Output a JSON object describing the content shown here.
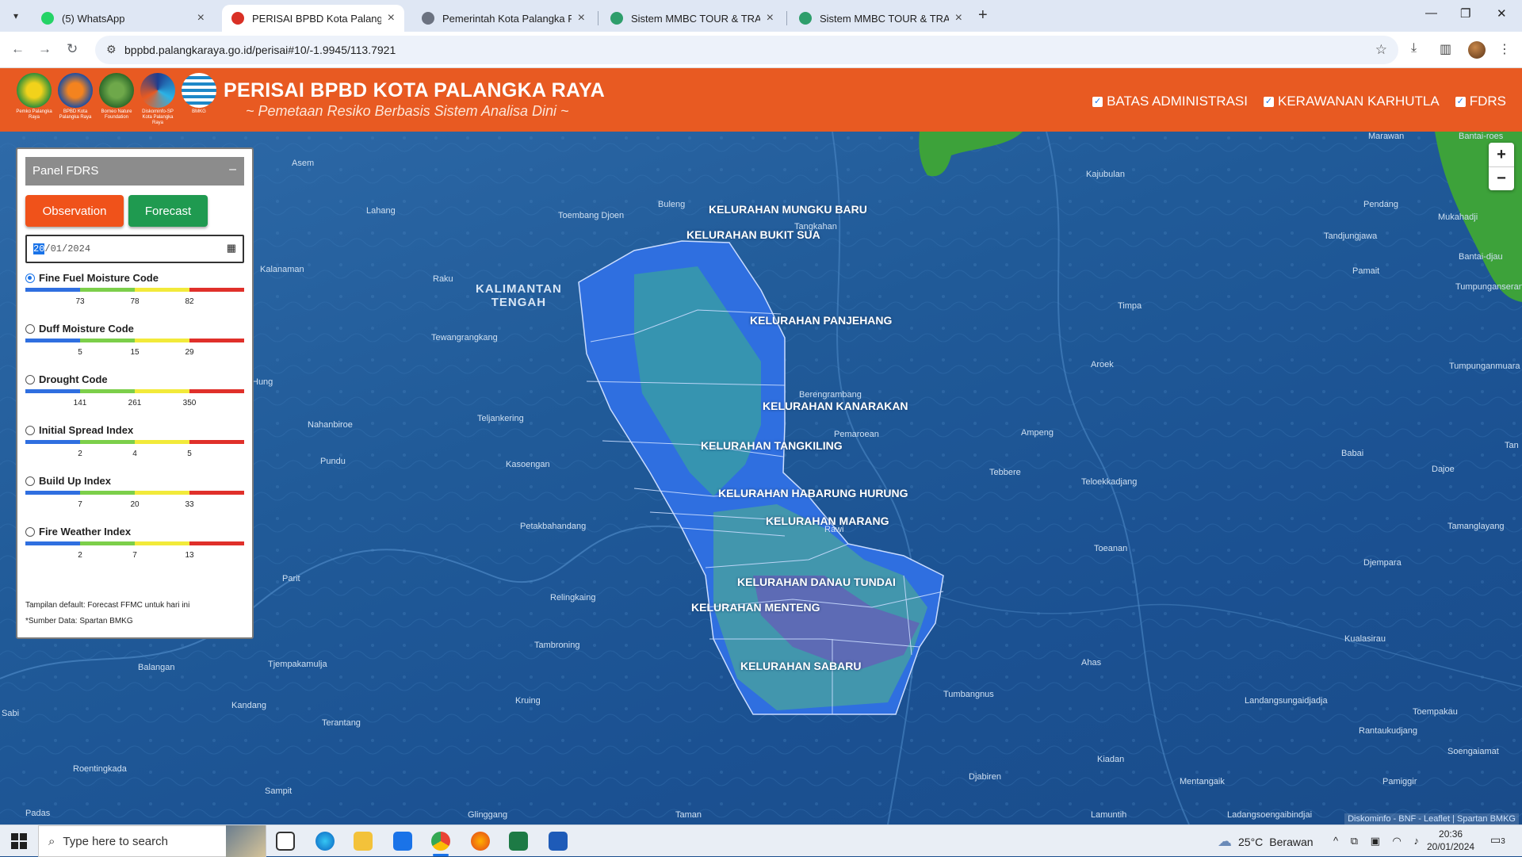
{
  "browser": {
    "tabs": [
      {
        "label": "(5) WhatsApp",
        "active": false,
        "color": "#25d366"
      },
      {
        "label": "PERISAI BPBD Kota Palangka Ra",
        "active": true,
        "color": "#d93025"
      },
      {
        "label": "Pemerintah Kota Palangka Raya",
        "active": false,
        "color": "#5f6368"
      },
      {
        "label": "Sistem MMBC TOUR & TRAVEL",
        "active": false,
        "color": "#2e9e6b"
      },
      {
        "label": "Sistem MMBC TOUR & TRAVEL",
        "active": false,
        "color": "#2e9e6b"
      }
    ],
    "url": "bppbd.palangkaraya.go.id/perisai#10/-1.9945/113.7921"
  },
  "header": {
    "title": "PERISAI BPBD KOTA PALANGKA RAYA",
    "subtitle": "~ Pemetaan Resiko Berbasis Sistem Analisa Dini ~",
    "logos": [
      {
        "caption": "Pemko Palangka Raya",
        "color": "#2f8f3a"
      },
      {
        "caption": "BPBD Kota Palangka Raya",
        "color": "#1f4fa0"
      },
      {
        "caption": "Borneo Nature Foundation",
        "color": "#2e6b2a"
      },
      {
        "caption": "Diskominfo-SP Kota Palangka Raya",
        "color": "#1d3d8f"
      },
      {
        "caption": "BMKG",
        "color": "#1e88c8"
      }
    ],
    "layers": [
      {
        "label": "BATAS ADMINISTRASI",
        "checked": true
      },
      {
        "label": "KERAWANAN KARHUTLA",
        "checked": true
      },
      {
        "label": "FDRS",
        "checked": true
      }
    ]
  },
  "panel": {
    "title": "Panel FDRS",
    "minimize": "–",
    "observation_label": "Observation",
    "forecast_label": "Forecast",
    "date_day": "20",
    "date_rest": "/01/2024",
    "scale_colors": [
      "#2f6fe0",
      "#7ccf4a",
      "#f2ea3a",
      "#e0302a"
    ],
    "indices": [
      {
        "label": "Fine Fuel Moisture Code",
        "selected": true,
        "ticks": [
          "73",
          "78",
          "82"
        ]
      },
      {
        "label": "Duff Moisture Code",
        "selected": false,
        "ticks": [
          "5",
          "15",
          "29"
        ]
      },
      {
        "label": "Drought Code",
        "selected": false,
        "ticks": [
          "141",
          "261",
          "350"
        ]
      },
      {
        "label": "Initial Spread Index",
        "selected": false,
        "ticks": [
          "2",
          "4",
          "5"
        ]
      },
      {
        "label": "Build Up Index",
        "selected": false,
        "ticks": [
          "7",
          "20",
          "33"
        ]
      },
      {
        "label": "Fire Weather Index",
        "selected": false,
        "ticks": [
          "2",
          "7",
          "13"
        ]
      }
    ],
    "note1": "Tampilan default: Forecast FFMC untuk hari ini",
    "note2": "*Sumber Data: Spartan BMKG"
  },
  "map": {
    "region": [
      "KALIMANTAN",
      "TENGAH"
    ],
    "kelurahan": [
      "KELURAHAN MUNGKU BARU",
      "KELURAHAN BUKIT SUA",
      "KELURAHAN PANJEHANG",
      "KELURAHAN KANARAKAN",
      "KELURAHAN TANGKILING",
      "KELURAHAN HABARUNG HURUNG",
      "KELURAHAN MARANG",
      "KELURAHAN DANAU TUNDAI",
      "KELURAHAN MENTENG",
      "KELURAHAN SABARU"
    ],
    "places": [
      "Asem",
      "Lahang",
      "Kalanaman",
      "Raku",
      "Tewangrangkang",
      "Toembang Djoen",
      "Buleng",
      "Tangkahan",
      "Kajubulan",
      "Pendang",
      "Tandjungjawa",
      "Pamait",
      "Timpa",
      "Aroek",
      "Berengrambang",
      "Teljankering",
      "Pundu",
      "Kasoengan",
      "Ampeng",
      "Babai",
      "Pemaroean",
      "Tebbere",
      "Teloekkadjang",
      "Dajoe",
      "Nahanbiroe",
      "Petakbahandang",
      "Rawi",
      "Toeanan",
      "Djempara",
      "Parit",
      "Relingkaing",
      "Balangan",
      "Tjempakamulja",
      "Tambroning",
      "Kualasirau",
      "Ahas",
      "Tumbangnus",
      "Landangsungaidjadja",
      "Kandang",
      "Terantang",
      "Kruing",
      "Rantaukudjang",
      "Roentingkada",
      "Sampit",
      "Kiadan",
      "Djabiren",
      "Mentangaik",
      "Pamiggir",
      "Padas",
      "Glinggang",
      "Taman",
      "Lamuntih",
      "Ladangsoengaibindjai",
      "Bantai-roes",
      "Mukahadji",
      "Bantai-djau",
      "Tumpunganserang",
      "Tumpunganmuara",
      "Tamanglayang",
      "Toempakau",
      "Soengaiamat",
      "Marawan",
      "Sabi",
      "Hung",
      "Tan"
    ],
    "attribution": "Diskominfo - BNF - Leaflet | Spartan BMKG",
    "zoom_in": "+",
    "zoom_out": "−"
  },
  "taskbar": {
    "search_placeholder": "Type here to search",
    "temp": "25°C",
    "weather": "Berawan",
    "time": "20:36",
    "date": "20/01/2024",
    "notifications": "3"
  }
}
